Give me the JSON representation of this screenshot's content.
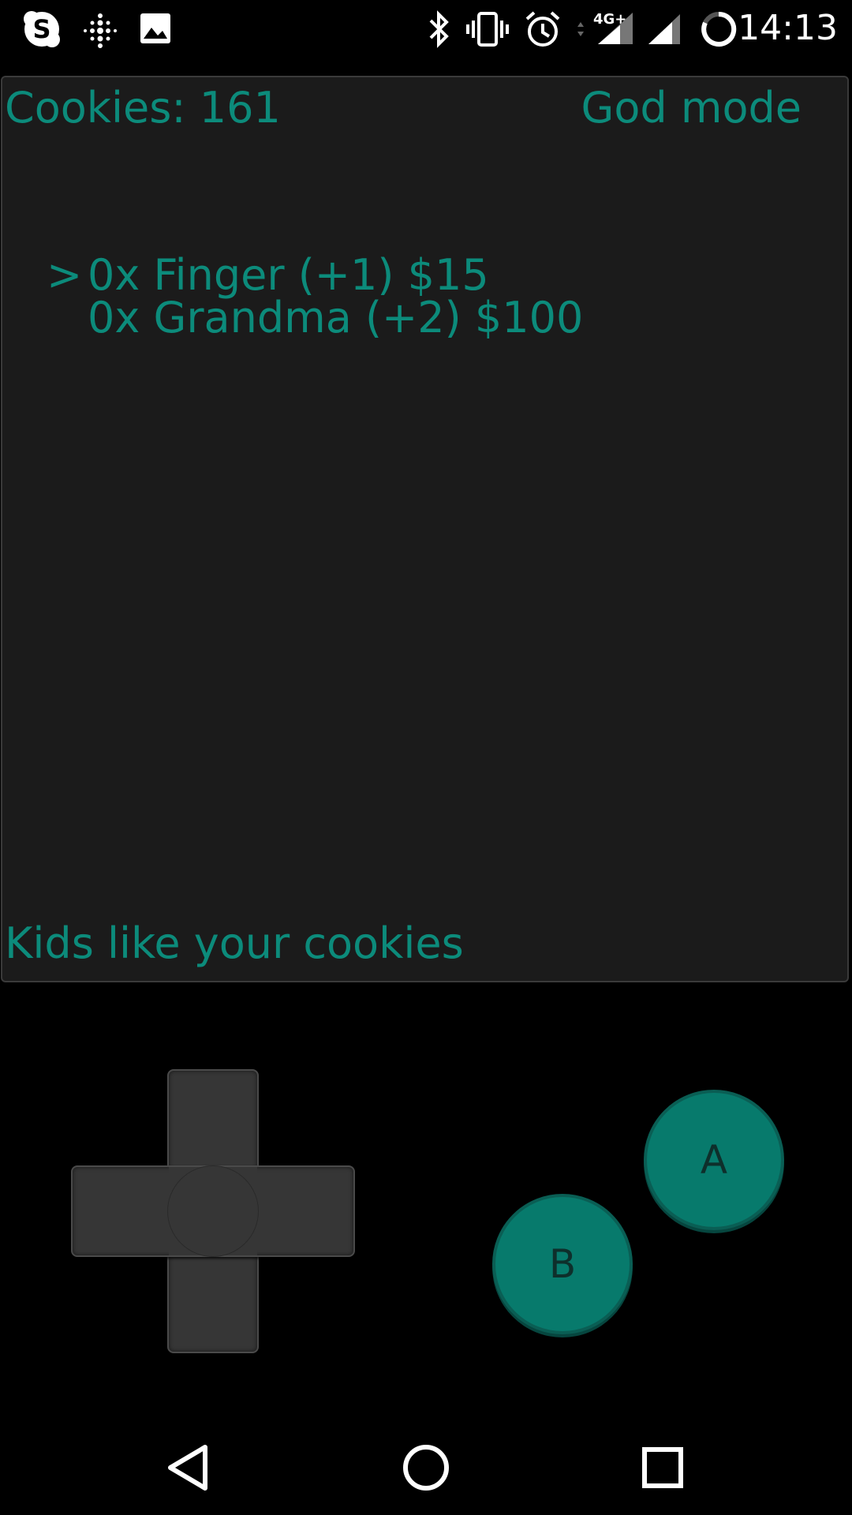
{
  "status_bar": {
    "time": "14:13",
    "left_icons": [
      "skype-icon",
      "fitbit-icon",
      "gallery-icon"
    ],
    "right_icons": [
      "bluetooth-icon",
      "vibrate-icon",
      "alarm-icon",
      "network-4g-plus-icon",
      "signal-icon",
      "signal-icon",
      "battery-icon"
    ],
    "network_label": "4G+"
  },
  "game": {
    "cookies_label": "Cookies: 161",
    "mode_label": "God mode",
    "cursor": ">",
    "items": [
      "0x Finger (+1) $15",
      "0x Grandma (+2) $100"
    ],
    "footer_message": "Kids like your cookies",
    "text_color": "#0c8b7b",
    "background_color": "#1b1b1b"
  },
  "controls": {
    "a_label": "A",
    "b_label": "B",
    "button_color": "#077a6c"
  },
  "nav_bar": {
    "icons": [
      "back-icon",
      "home-icon",
      "recents-icon"
    ]
  }
}
